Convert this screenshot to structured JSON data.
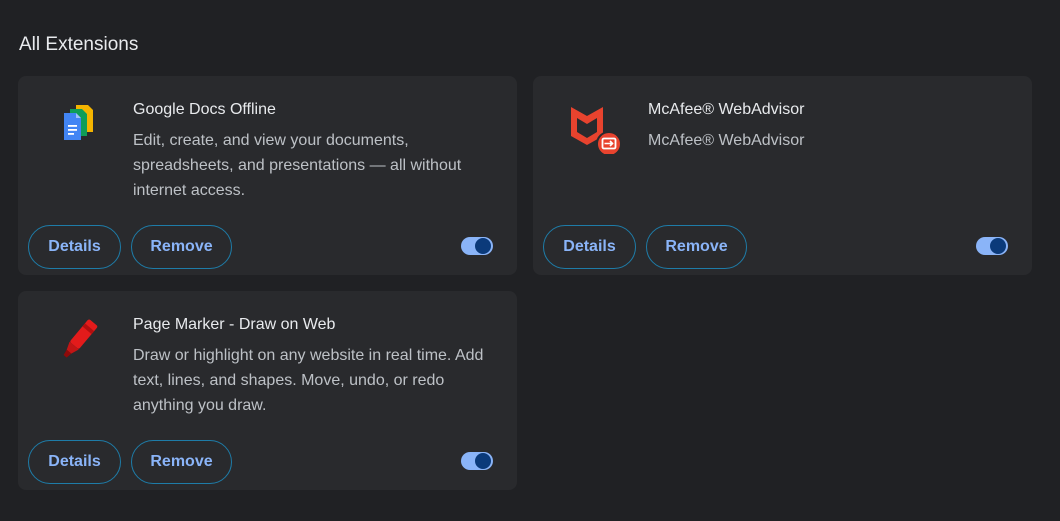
{
  "section": {
    "title": "All Extensions"
  },
  "extensions": [
    {
      "name": "Google Docs Offline",
      "description": "Edit, create, and view your documents, spreadsheets, and presentations — all without internet access.",
      "details_label": "Details",
      "remove_label": "Remove",
      "enabled": true,
      "icon": "google-docs-offline-icon"
    },
    {
      "name": "McAfee® WebAdvisor",
      "description": "McAfee® WebAdvisor",
      "details_label": "Details",
      "remove_label": "Remove",
      "enabled": true,
      "icon": "mcafee-webadvisor-icon"
    },
    {
      "name": "Page Marker - Draw on Web",
      "description": "Draw or highlight on any website in real time. Add text, lines, and shapes. Move, undo, or redo anything you draw.",
      "details_label": "Details",
      "remove_label": "Remove",
      "enabled": true,
      "icon": "page-marker-icon"
    }
  ],
  "colors": {
    "background": "#202124",
    "card": "#292a2d",
    "accent": "#8ab4f8",
    "button_border": "#1e7ca8",
    "mcafee_red": "#e8432e"
  }
}
